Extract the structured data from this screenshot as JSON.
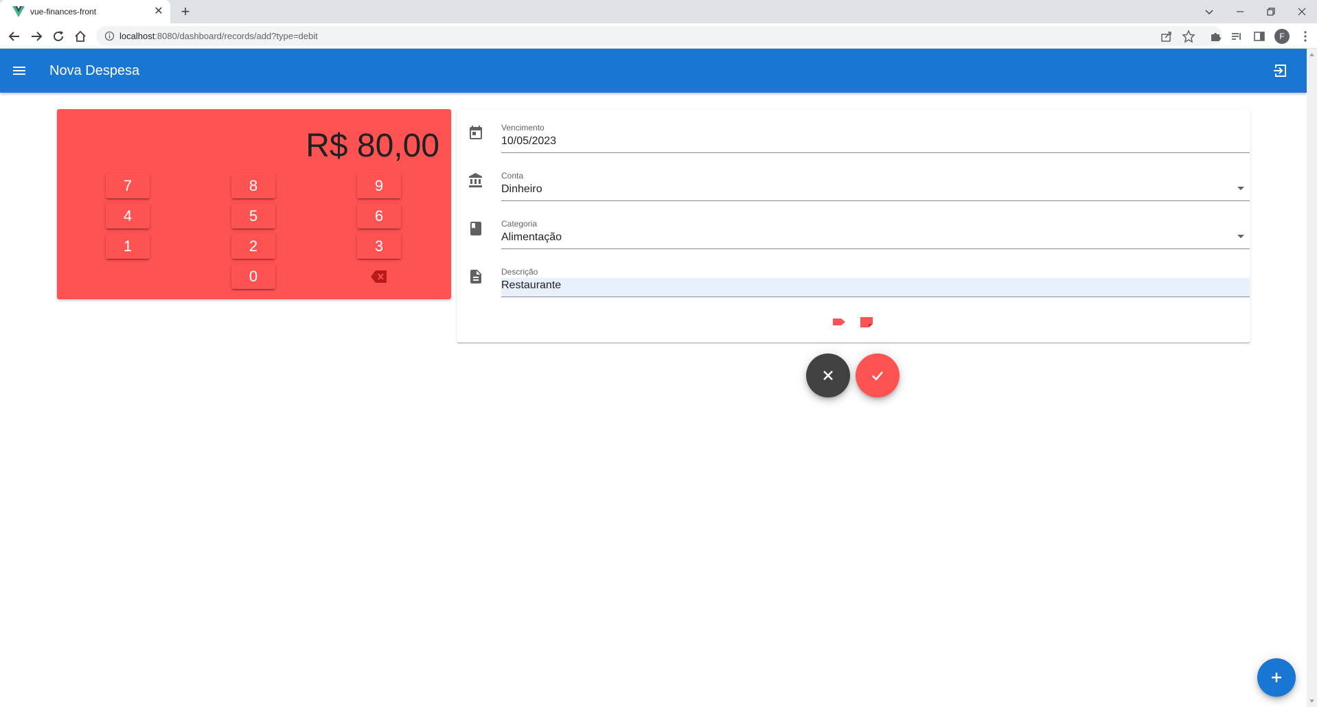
{
  "browser": {
    "tab_title": "vue-finances-front",
    "url_host": "localhost",
    "url_path": ":8080/dashboard/records/add?type=debit",
    "profile_initial": "F"
  },
  "appbar": {
    "title": "Nova Despesa"
  },
  "keypad": {
    "amount": "R$ 80,00",
    "keys": [
      "7",
      "8",
      "9",
      "4",
      "5",
      "6",
      "1",
      "2",
      "3",
      "0"
    ],
    "color": "#ff5252"
  },
  "form": {
    "due_date": {
      "label": "Vencimento",
      "value": "10/05/2023",
      "icon": "calendar-icon"
    },
    "account": {
      "label": "Conta",
      "value": "Dinheiro",
      "icon": "bank-icon"
    },
    "category": {
      "label": "Categoria",
      "value": "Alimentação",
      "icon": "book-icon"
    },
    "description": {
      "label": "Descrição",
      "value": "Restaurante",
      "icon": "document-icon"
    }
  },
  "colors": {
    "primary": "#1976d2",
    "accent": "#ff5252",
    "dark": "#424242"
  }
}
